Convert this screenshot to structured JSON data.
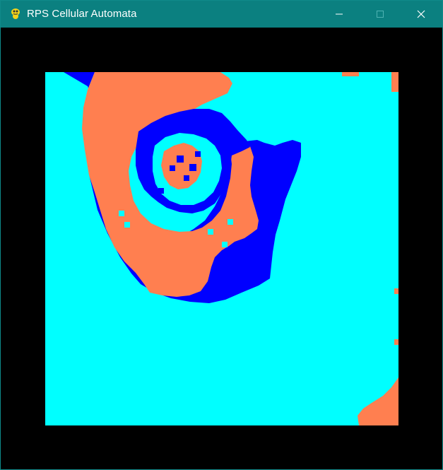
{
  "window": {
    "title": "RPS Cellular Automata",
    "icon": "pygame-snake-icon",
    "controls": {
      "minimize_icon": "minimize-icon",
      "maximize_icon": "maximize-icon",
      "close_icon": "close-icon"
    }
  },
  "colors": {
    "titlebar": "#0b8080",
    "background": "#000000",
    "cyan": "#00ffff",
    "blue": "#0000ff",
    "orange": "#ff7f50"
  },
  "automaton": {
    "states": [
      "cyan",
      "orange",
      "blue"
    ]
  }
}
